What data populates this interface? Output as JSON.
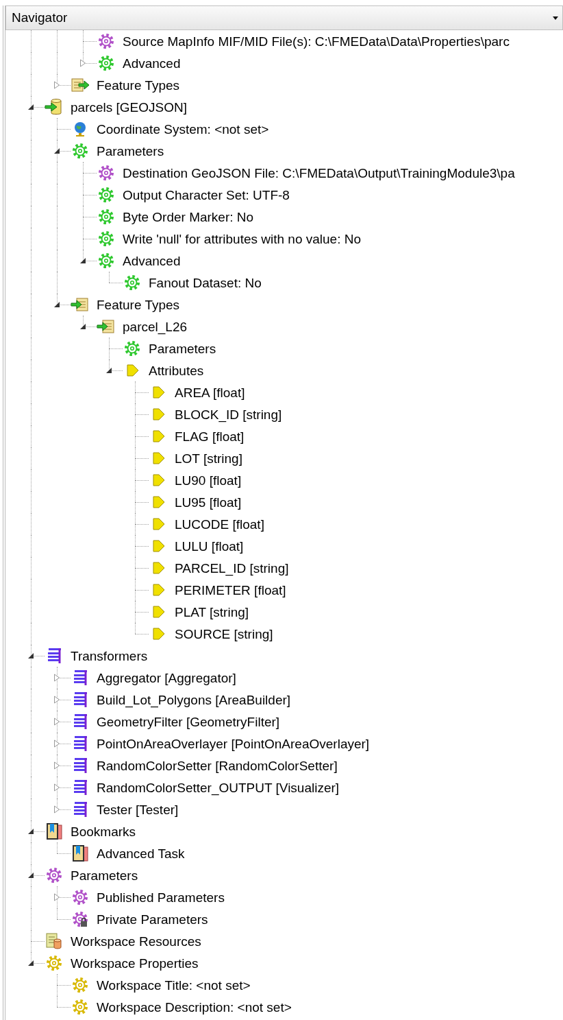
{
  "panel": {
    "title": "Navigator"
  },
  "tree": [
    {
      "children": [
        {
          "children": [
            {
              "label": "Source MapInfo MIF/MID File(s): C:\\FMEData\\Data\\Properties\\parc",
              "kind": "user-param"
            },
            {
              "label": "Advanced",
              "kind": "param",
              "expanded": false
            }
          ]
        },
        {
          "label": "Feature Types",
          "kind": "feature-types",
          "expanded": false
        }
      ]
    },
    {
      "label": "parcels [GEOJSON]",
      "kind": "writer",
      "expanded": true,
      "children": [
        {
          "label": "Coordinate System: <not set>",
          "kind": "globe"
        },
        {
          "label": "Parameters",
          "kind": "param",
          "expanded": true,
          "children": [
            {
              "label": "Destination GeoJSON File: C:\\FMEData\\Output\\TrainingModule3\\pa",
              "kind": "user-param"
            },
            {
              "label": "Output Character Set: UTF-8",
              "kind": "param"
            },
            {
              "label": "Byte Order Marker: No",
              "kind": "param"
            },
            {
              "label": "Write 'null' for attributes with no value: No",
              "kind": "param"
            },
            {
              "label": "Advanced",
              "kind": "param",
              "expanded": true,
              "children": [
                {
                  "label": "Fanout Dataset: No",
                  "kind": "param"
                }
              ]
            }
          ]
        },
        {
          "label": "Feature Types",
          "kind": "feature-types-out",
          "expanded": true,
          "children": [
            {
              "label": "parcel_L26",
              "kind": "feature-types-out",
              "expanded": true,
              "children": [
                {
                  "label": "Parameters",
                  "kind": "param"
                },
                {
                  "label": "Attributes",
                  "kind": "attribute",
                  "expanded": true,
                  "children": [
                    {
                      "label": "AREA [float]",
                      "kind": "attribute"
                    },
                    {
                      "label": "BLOCK_ID [string]",
                      "kind": "attribute"
                    },
                    {
                      "label": "FLAG [float]",
                      "kind": "attribute"
                    },
                    {
                      "label": "LOT [string]",
                      "kind": "attribute"
                    },
                    {
                      "label": "LU90 [float]",
                      "kind": "attribute"
                    },
                    {
                      "label": "LU95 [float]",
                      "kind": "attribute"
                    },
                    {
                      "label": "LUCODE [float]",
                      "kind": "attribute"
                    },
                    {
                      "label": "LULU [float]",
                      "kind": "attribute"
                    },
                    {
                      "label": "PARCEL_ID [string]",
                      "kind": "attribute"
                    },
                    {
                      "label": "PERIMETER [float]",
                      "kind": "attribute"
                    },
                    {
                      "label": "PLAT [string]",
                      "kind": "attribute"
                    },
                    {
                      "label": "SOURCE [string]",
                      "kind": "attribute"
                    }
                  ]
                }
              ]
            }
          ]
        }
      ]
    },
    {
      "label": "Transformers",
      "kind": "transformer",
      "expanded": true,
      "children": [
        {
          "label": "Aggregator [Aggregator]",
          "kind": "transformer",
          "expanded": false
        },
        {
          "label": "Build_Lot_Polygons [AreaBuilder]",
          "kind": "transformer",
          "expanded": false
        },
        {
          "label": "GeometryFilter [GeometryFilter]",
          "kind": "transformer",
          "expanded": false
        },
        {
          "label": "PointOnAreaOverlayer [PointOnAreaOverlayer]",
          "kind": "transformer",
          "expanded": false
        },
        {
          "label": "RandomColorSetter [RandomColorSetter]",
          "kind": "transformer",
          "expanded": false
        },
        {
          "label": "RandomColorSetter_OUTPUT [Visualizer]",
          "kind": "transformer",
          "expanded": false
        },
        {
          "label": "Tester [Tester]",
          "kind": "transformer",
          "expanded": false
        }
      ]
    },
    {
      "label": "Bookmarks",
      "kind": "bookmark",
      "expanded": true,
      "children": [
        {
          "label": "Advanced Task",
          "kind": "bookmark"
        }
      ]
    },
    {
      "label": "Parameters",
      "kind": "user-param",
      "expanded": true,
      "children": [
        {
          "label": "Published Parameters",
          "kind": "user-param",
          "expanded": false
        },
        {
          "label": "Private Parameters",
          "kind": "private-param"
        }
      ]
    },
    {
      "label": "Workspace Resources",
      "kind": "resources"
    },
    {
      "label": "Workspace Properties",
      "kind": "workspace-prop",
      "expanded": true,
      "children": [
        {
          "label": "Workspace Title: <not set>",
          "kind": "workspace-prop"
        },
        {
          "label": "Workspace Description: <not set>",
          "kind": "workspace-prop"
        }
      ]
    }
  ]
}
